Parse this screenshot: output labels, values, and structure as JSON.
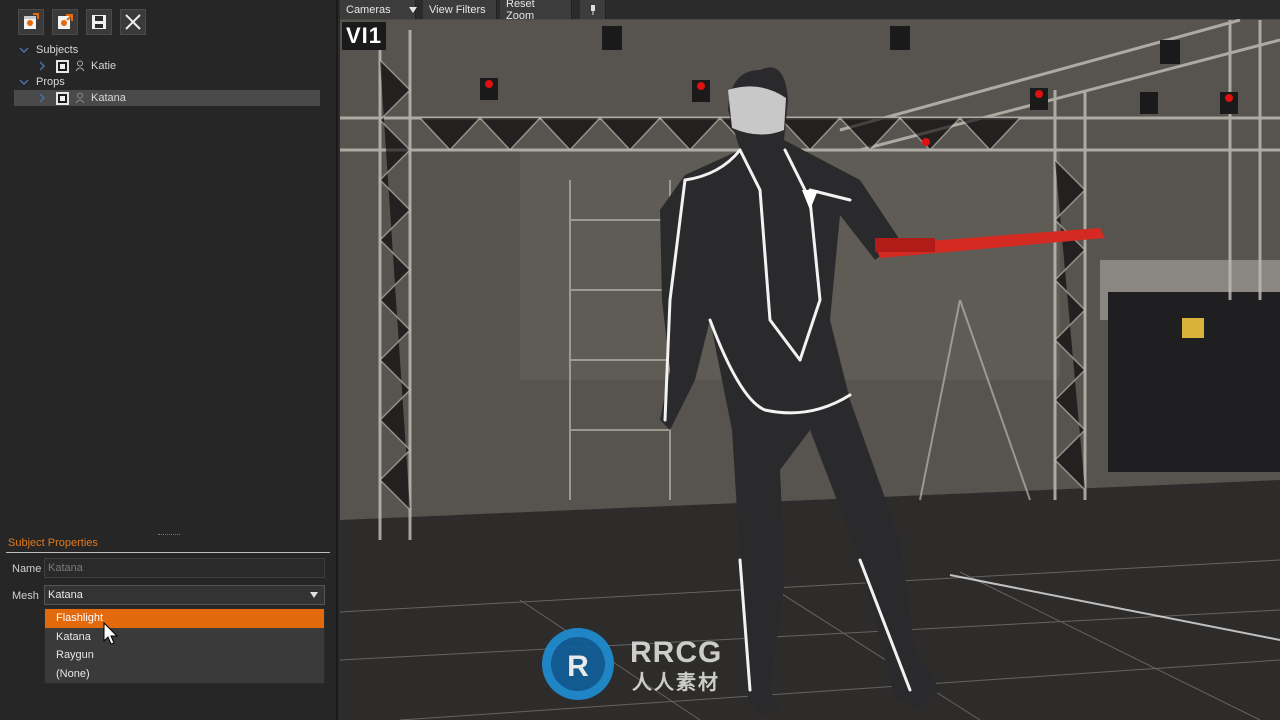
{
  "toolbar": {
    "icons": [
      "import-subject-icon",
      "export-subject-icon",
      "save-icon",
      "close-icon"
    ]
  },
  "tree": {
    "groups": [
      {
        "label": "Subjects",
        "items": [
          {
            "label": "Katie",
            "checked": true,
            "selected": false
          }
        ]
      },
      {
        "label": "Props",
        "items": [
          {
            "label": "Katana",
            "checked": true,
            "selected": true
          }
        ]
      }
    ]
  },
  "properties": {
    "title": "Subject Properties",
    "name_label": "Name",
    "name_value": "Katana",
    "mesh_label": "Mesh",
    "mesh_value": "Katana",
    "mesh_options": [
      "Flashlight",
      "Katana",
      "Raygun",
      "(None)"
    ],
    "highlighted_option": "Flashlight"
  },
  "viewport": {
    "cameras_label": "Cameras",
    "view_filters_label": "View Filters",
    "reset_zoom_label": "Reset Zoom",
    "view_label": "VI1"
  },
  "watermark": {
    "main": "RRCG",
    "sub": "人人素材"
  },
  "colors": {
    "accent": "#e2690c",
    "prop_red": "#d42a22",
    "panel": "#262626"
  }
}
